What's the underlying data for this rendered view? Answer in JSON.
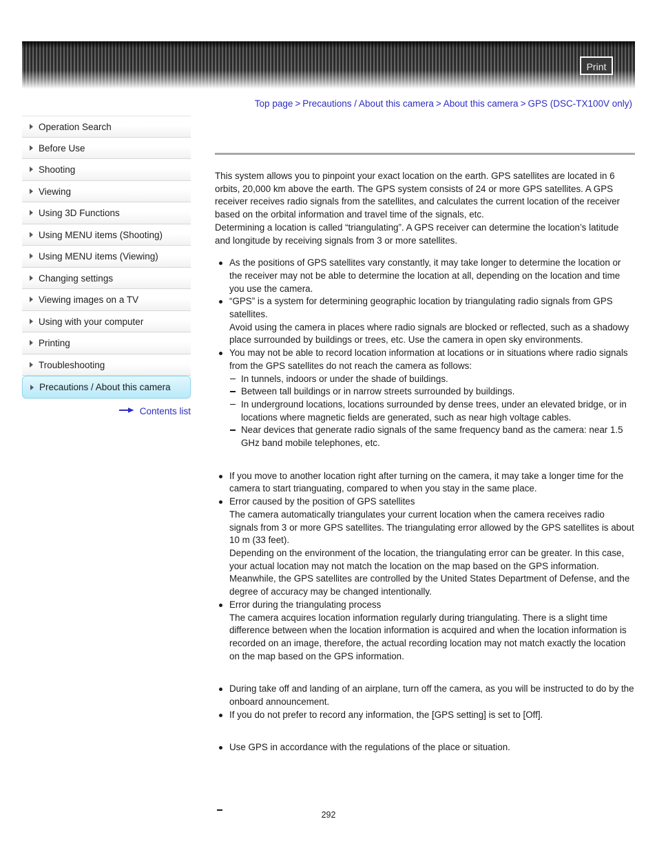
{
  "header": {
    "print_label": "Print"
  },
  "breadcrumb": {
    "separator": ">",
    "items": [
      "Top page",
      "Precautions / About this camera",
      "About this camera",
      "GPS (DSC-TX100V only)"
    ]
  },
  "sidebar": {
    "items": [
      {
        "label": "Operation Search",
        "active": false
      },
      {
        "label": "Before Use",
        "active": false
      },
      {
        "label": "Shooting",
        "active": false
      },
      {
        "label": "Viewing",
        "active": false
      },
      {
        "label": "Using 3D Functions",
        "active": false
      },
      {
        "label": "Using MENU items (Shooting)",
        "active": false
      },
      {
        "label": "Using MENU items (Viewing)",
        "active": false
      },
      {
        "label": "Changing settings",
        "active": false
      },
      {
        "label": "Viewing images on a TV",
        "active": false
      },
      {
        "label": "Using with your computer",
        "active": false
      },
      {
        "label": "Printing",
        "active": false
      },
      {
        "label": "Troubleshooting",
        "active": false
      },
      {
        "label": "Precautions / About this camera",
        "active": true
      }
    ],
    "contents_link": "Contents list"
  },
  "content": {
    "intro": "This system allows you to pinpoint your exact location on the earth. GPS satellites are located in 6 orbits, 20,000 km above the earth. The GPS system consists of 24 or more GPS satellites. A GPS receiver receives radio signals from the satellites, and calculates the current location of the receiver based on the orbital information and travel time of the signals, etc.\nDetermining a location is called “triangulating”. A GPS receiver can determine the location’s latitude and longitude by receiving signals from 3 or more satellites.",
    "group1": [
      "As the positions of GPS satellites vary constantly, it may take longer to determine the location or the receiver may not be able to determine the location at all, depending on the location and time you use the camera.",
      "“GPS” is a system for determining geographic location by triangulating radio signals from GPS satellites.\nAvoid using the camera in places where radio signals are blocked or reflected, such as a shadowy place surrounded by buildings or trees, etc. Use the camera in open sky environments.",
      "You may not be able to record location information at locations or in situations where radio signals from the GPS satellites do not reach the camera as follows:"
    ],
    "group1_sublist": [
      "In tunnels, indoors or under the shade of buildings.",
      "Between tall buildings or in narrow streets surrounded by buildings.",
      "In underground locations, locations surrounded by dense trees, under an elevated bridge, or in locations where magnetic fields are generated, such as near high voltage cables.",
      "Near devices that generate radio signals of the same frequency band as the camera: near 1.5 GHz band mobile telephones, etc."
    ],
    "group2": [
      "If you move to another location right after turning on the camera, it may take a longer time for the camera to start trianguating, compared to when you stay in the same place.",
      "Error caused by the position of GPS satellites\nThe camera automatically triangulates your current location when the camera receives radio signals from 3 or more GPS satellites. The triangulating error allowed by the GPS satellites is about 10 m (33 feet).\nDepending on the environment of the location, the triangulating error can be greater. In this case, your actual location may not match the location on the map based on the GPS information. Meanwhile, the GPS satellites are controlled by the United States Department of Defense, and the degree of accuracy may be changed intentionally.",
      "Error during the triangulating process\nThe camera acquires location information regularly during triangulating. There is a slight time difference between when the location information is acquired and when the location information is recorded on an image, therefore, the actual recording location may not match exactly the location on the map based on the GPS information."
    ],
    "group3": [
      "During take off and landing of an airplane, turn off the camera, as you will be instructed to do by the onboard announcement.",
      "If you do not prefer to record any information, the [GPS setting] is set to [Off]."
    ],
    "group4": [
      "Use GPS in accordance with the regulations of the place or situation."
    ]
  },
  "footer": {
    "page_number": "292"
  },
  "colors": {
    "link": "#2c2cc4",
    "rule": "#a8a8a8",
    "active_nav_bg": "#ccf0fb",
    "active_nav_border": "#8fd9ef",
    "header_dark": "#2e2e2e"
  }
}
